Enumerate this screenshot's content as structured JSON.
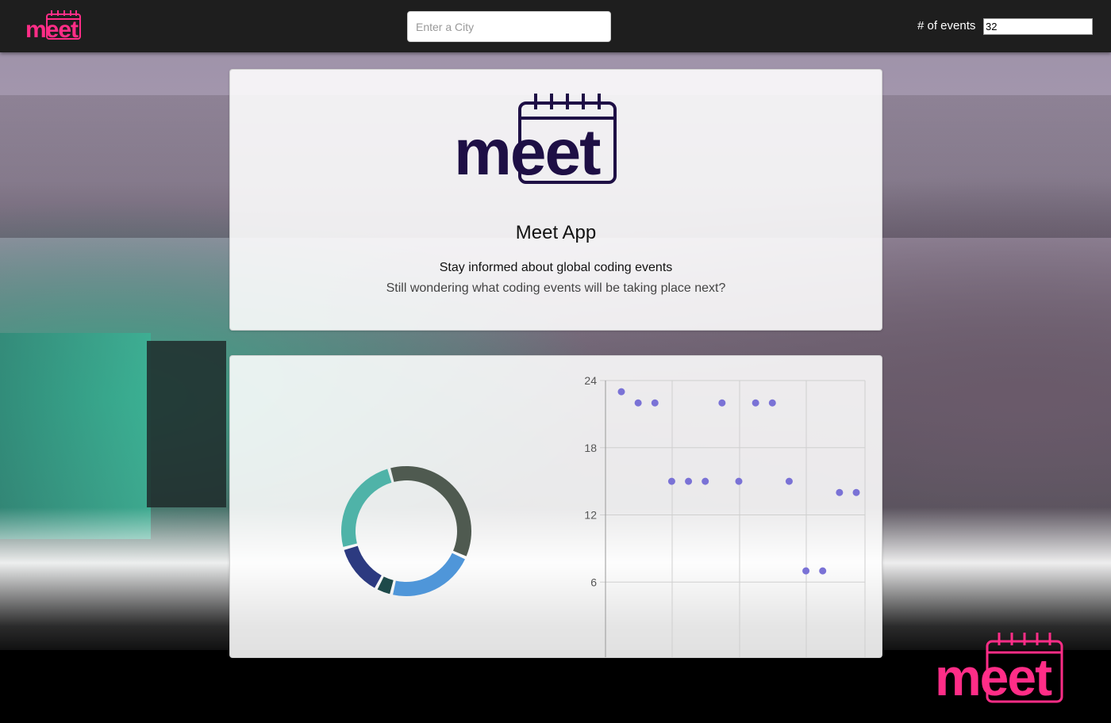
{
  "header": {
    "logo_text": "meet",
    "city_placeholder": "Enter a City",
    "events_label": "# of events",
    "events_value": "32"
  },
  "intro": {
    "logo_text": "meet",
    "title": "Meet App",
    "subtitle": "Stay informed about global coding events",
    "description": "Still wondering what coding events will be taking place next?"
  },
  "colors": {
    "header_bg": "#1e1e1e",
    "brand_pink": "#ff2d87",
    "logo_dark": "#1e0f45",
    "scatter_point": "#7a72d6"
  },
  "chart_data": [
    {
      "type": "pie",
      "title": "",
      "slices": [
        {
          "value": 36,
          "color": "#4f5a50"
        },
        {
          "value": 22,
          "color": "#4f96d9"
        },
        {
          "value": 4,
          "color": "#1e4a4a"
        },
        {
          "value": 13,
          "color": "#2c3a80"
        },
        {
          "value": 25,
          "color": "#4fb3a8"
        }
      ]
    },
    {
      "type": "scatter",
      "title": "",
      "xlabel": "",
      "ylabel": "",
      "ylim": [
        0,
        24
      ],
      "yticks": [
        "24",
        "18",
        "12",
        "6"
      ],
      "grid": true,
      "points": [
        {
          "x": 0,
          "y": 23
        },
        {
          "x": 1,
          "y": 22
        },
        {
          "x": 2,
          "y": 22
        },
        {
          "x": 3,
          "y": 15
        },
        {
          "x": 4,
          "y": 15
        },
        {
          "x": 5,
          "y": 15
        },
        {
          "x": 6,
          "y": 22
        },
        {
          "x": 7,
          "y": 15
        },
        {
          "x": 8,
          "y": 22
        },
        {
          "x": 9,
          "y": 22
        },
        {
          "x": 10,
          "y": 15
        },
        {
          "x": 11,
          "y": 7
        },
        {
          "x": 12,
          "y": 7
        },
        {
          "x": 13,
          "y": 14
        },
        {
          "x": 14,
          "y": 14
        }
      ]
    }
  ]
}
